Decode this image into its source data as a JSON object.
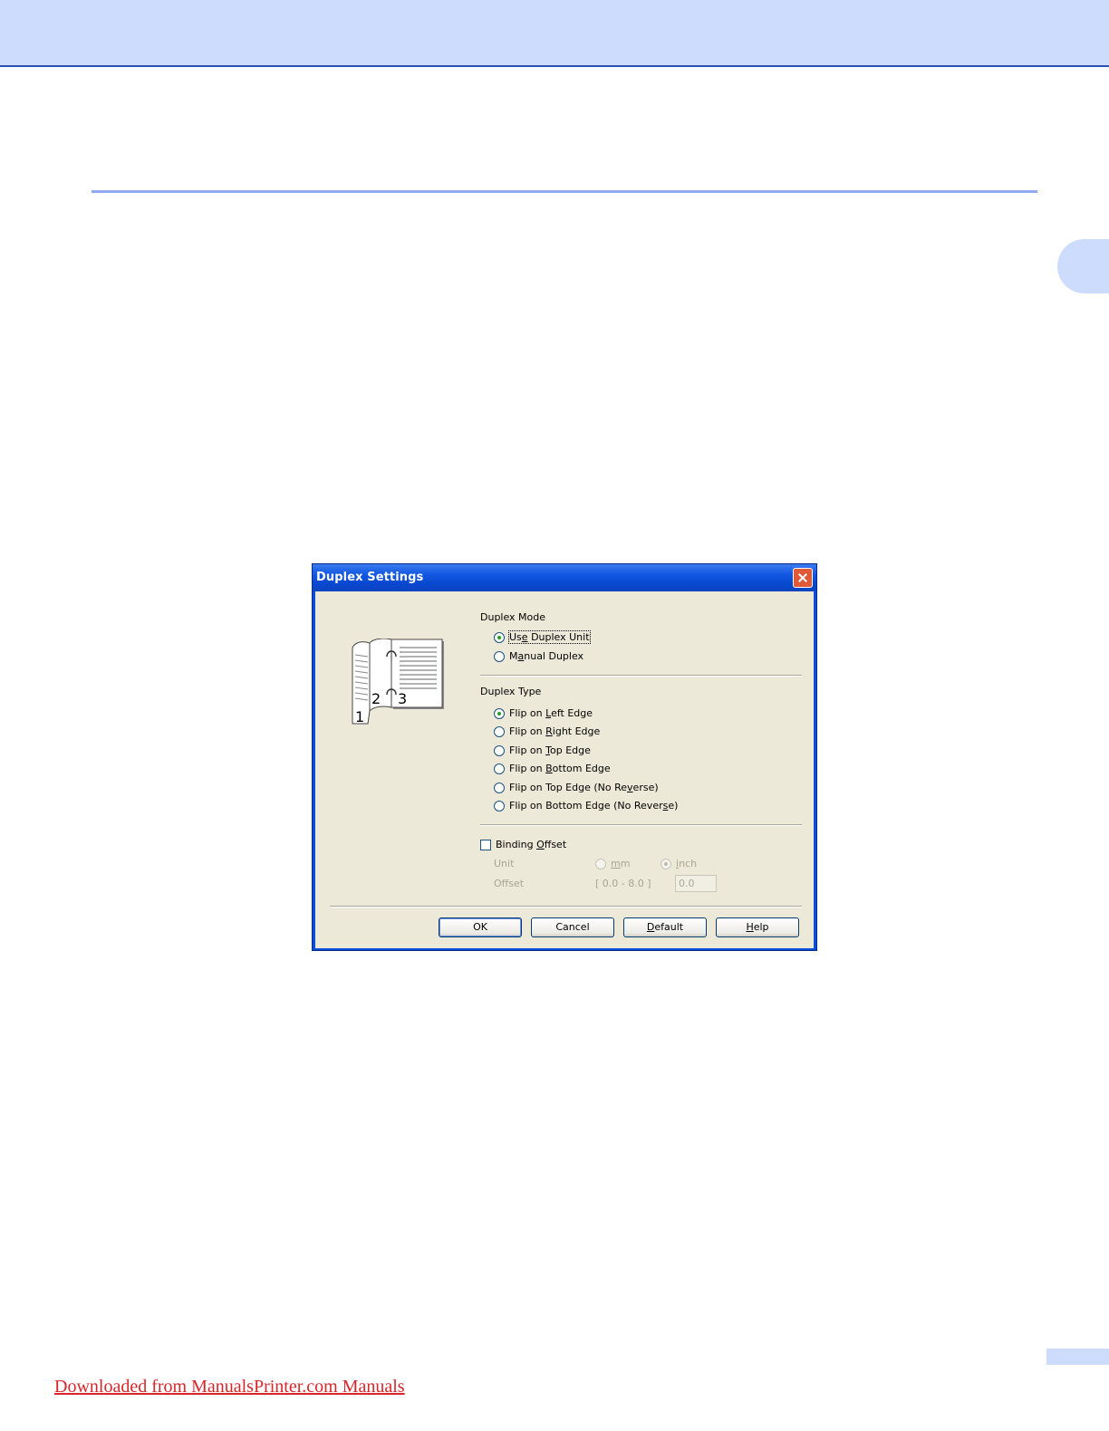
{
  "footer": {
    "link_text": "Downloaded from ManualsPrinter.com Manuals"
  },
  "dialog": {
    "title": "Duplex Settings",
    "preview_numbers": [
      "1",
      "2",
      "3"
    ],
    "duplex_mode": {
      "label": "Duplex Mode",
      "options": [
        {
          "pre": "Us",
          "key": "e",
          "post": " Duplex Unit",
          "checked": true
        },
        {
          "pre": "M",
          "key": "a",
          "post": "nual Duplex",
          "checked": false
        }
      ]
    },
    "duplex_type": {
      "label": "Duplex Type",
      "options": [
        {
          "pre": "Flip on ",
          "key": "L",
          "post": "eft Edge",
          "checked": true
        },
        {
          "pre": "Flip on ",
          "key": "R",
          "post": "ight Edge",
          "checked": false
        },
        {
          "pre": "Flip on ",
          "key": "T",
          "post": "op Edge",
          "checked": false
        },
        {
          "pre": "Flip on ",
          "key": "B",
          "post": "ottom Edge",
          "checked": false
        },
        {
          "pre": "Flip on Top Edge (No Re",
          "key": "v",
          "post": "erse)",
          "checked": false
        },
        {
          "pre": "Flip on Bottom Edge (No Rever",
          "key": "s",
          "post": "e)",
          "checked": false
        }
      ]
    },
    "binding_offset": {
      "pre": "Binding ",
      "key": "O",
      "post": "ffset",
      "checked": false,
      "unit_label": "Unit",
      "unit_mm_pre": "",
      "unit_mm_key": "m",
      "unit_mm_post": "m",
      "unit_inch_pre": "",
      "unit_inch_key": "i",
      "unit_inch_post": "nch",
      "offset_label": "Offset",
      "offset_range": "[ 0.0 - 8.0 ]",
      "offset_value": "0.0"
    },
    "buttons": {
      "ok": "OK",
      "cancel": "Cancel",
      "default_key": "D",
      "default_rest": "efault",
      "help_key": "H",
      "help_rest": "elp"
    }
  }
}
